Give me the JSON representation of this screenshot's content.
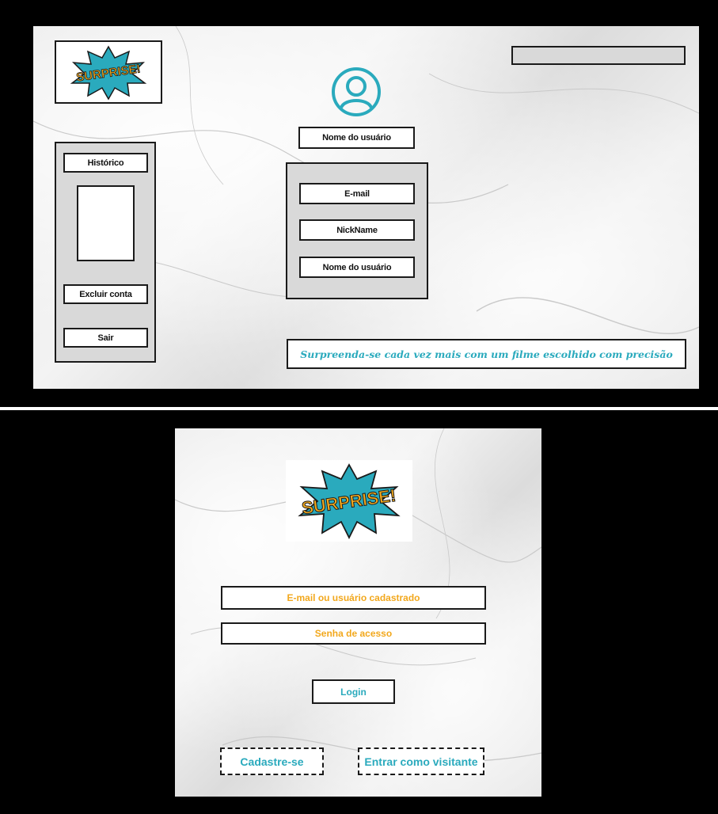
{
  "profile_screen": {
    "logo_text": "SURPRISE!",
    "search_bar_value": "",
    "user_icon": "user-circle-icon",
    "username_label": "Nome do usuário",
    "sidebar": {
      "history_label": "Histórico",
      "delete_account_label": "Excluir conta",
      "logout_label": "Sair"
    },
    "info_panel": {
      "email_label": "E-mail",
      "nickname_label": "NickName",
      "username_label": "Nome do usuário"
    },
    "tagline": "Surpreenda-se cada vez mais com um filme escolhido com precisão"
  },
  "login_screen": {
    "logo_text": "SURPRISE!",
    "email_placeholder": "E-mail ou usuário cadastrado",
    "password_placeholder": "Senha de acesso",
    "login_label": "Login",
    "signup_label": "Cadastre-se",
    "guest_label": "Entrar como visitante"
  },
  "colors": {
    "accent_teal": "#2aaabd",
    "accent_orange": "#f2a81d",
    "panel_gray": "#d9d9d9"
  }
}
